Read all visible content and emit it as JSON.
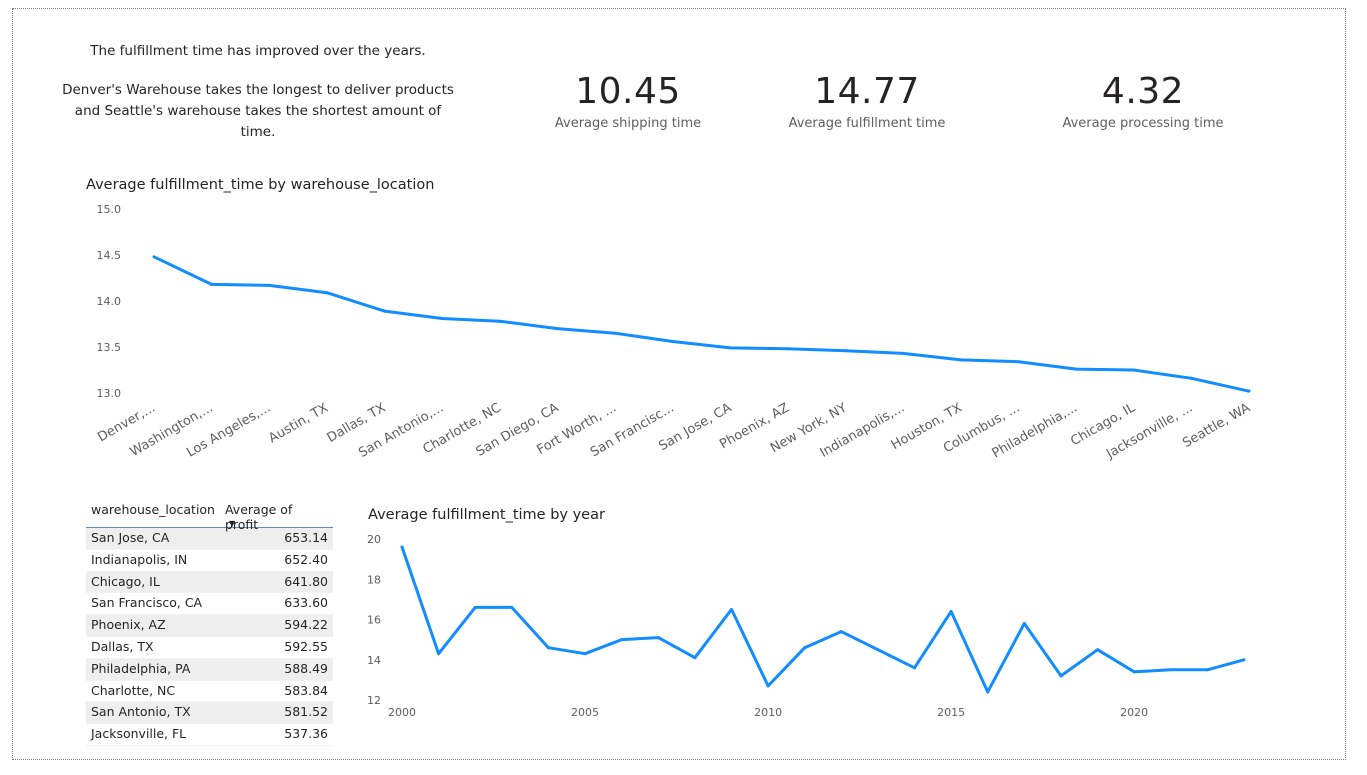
{
  "insights": {
    "line1": "The fulfillment time has improved over the years.",
    "line2": "Denver's Warehouse takes the longest to deliver products and Seattle's warehouse takes the shortest amount of time."
  },
  "kpis": [
    {
      "value": "10.45",
      "label": "Average shipping time"
    },
    {
      "value": "14.77",
      "label": "Average fulfillment time"
    },
    {
      "value": "4.32",
      "label": "Average processing time"
    }
  ],
  "colors": {
    "line": "#118DFF",
    "text": "#252423",
    "axis": "#605e5c"
  },
  "table": {
    "headers": [
      "warehouse_location",
      "Average of profit"
    ],
    "rows": [
      [
        "San Jose, CA",
        "653.14"
      ],
      [
        "Indianapolis, IN",
        "652.40"
      ],
      [
        "Chicago, IL",
        "641.80"
      ],
      [
        "San Francisco, CA",
        "633.60"
      ],
      [
        "Phoenix, AZ",
        "594.22"
      ],
      [
        "Dallas, TX",
        "592.55"
      ],
      [
        "Philadelphia, PA",
        "588.49"
      ],
      [
        "Charlotte, NC",
        "583.84"
      ],
      [
        "San Antonio, TX",
        "581.52"
      ],
      [
        "Jacksonville, FL",
        "537.36"
      ]
    ]
  },
  "chart_data": [
    {
      "type": "line",
      "title": "Average fulfillment_time by warehouse_location",
      "categories": [
        "Denver,...",
        "Washington,...",
        "Los Angeles,...",
        "Austin, TX",
        "Dallas, TX",
        "San Antonio,...",
        "Charlotte, NC",
        "San Diego, CA",
        "Fort Worth, ...",
        "San Francisc...",
        "San Jose, CA",
        "Phoenix, AZ",
        "New York, NY",
        "Indianapolis,...",
        "Houston, TX",
        "Columbus, ...",
        "Philadelphia,...",
        "Chicago, IL",
        "Jacksonville, ...",
        "Seattle, WA"
      ],
      "values": [
        14.48,
        14.18,
        14.17,
        14.09,
        13.89,
        13.81,
        13.78,
        13.7,
        13.65,
        13.56,
        13.49,
        13.48,
        13.46,
        13.43,
        13.36,
        13.34,
        13.26,
        13.25,
        13.16,
        13.02
      ],
      "yticks": [
        "15.0",
        "14.5",
        "14.0",
        "13.5",
        "13.0"
      ],
      "ylim": [
        13.0,
        15.0
      ],
      "grid": false
    },
    {
      "type": "line",
      "title": "Average fulfillment_time by year",
      "x": [
        2000,
        2001,
        2002,
        2003,
        2004,
        2005,
        2006,
        2007,
        2008,
        2009,
        2010,
        2011,
        2012,
        2013,
        2014,
        2015,
        2016,
        2017,
        2018,
        2019,
        2020,
        2021,
        2022,
        2023
      ],
      "values": [
        19.6,
        14.3,
        16.6,
        16.6,
        14.6,
        14.3,
        15.0,
        15.1,
        14.1,
        16.5,
        12.7,
        14.6,
        15.4,
        14.5,
        13.6,
        16.4,
        12.4,
        15.8,
        13.2,
        14.5,
        13.4,
        13.5,
        13.5,
        14.0
      ],
      "yticks": [
        "20",
        "18",
        "16",
        "14",
        "12"
      ],
      "xticks": [
        "2000",
        "2005",
        "2010",
        "2015",
        "2020"
      ],
      "ylim": [
        12,
        20
      ],
      "xlim": [
        2000,
        2023
      ],
      "grid": false
    }
  ]
}
